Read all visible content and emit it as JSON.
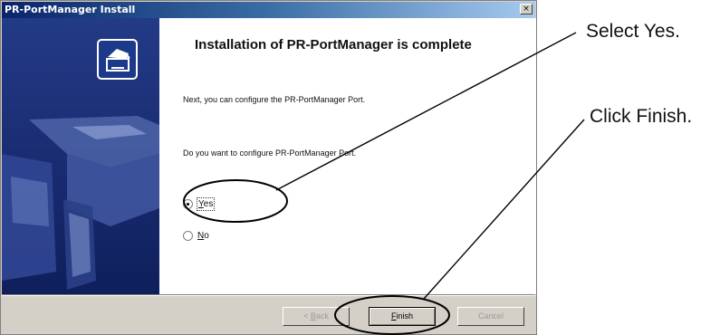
{
  "window": {
    "title": "PR-PortManager Install",
    "close_glyph": "×"
  },
  "content": {
    "heading": "Installation of PR-PortManager is complete",
    "message1": "Next, you can configure the PR-PortManager Port.",
    "message2": "Do you want to configure PR-PortManager Port.",
    "options": [
      {
        "accesskey": "Y",
        "rest": "es",
        "selected": true
      },
      {
        "accesskey": "N",
        "rest": "o",
        "selected": false
      }
    ]
  },
  "buttons": {
    "back_prefix": "< ",
    "back_key": "B",
    "back_rest": "ack",
    "finish_key": "F",
    "finish_rest": "inish",
    "cancel": "Cancel"
  },
  "annotations": {
    "select_yes": "Select Yes.",
    "click_finish": "Click Finish."
  },
  "icons": [
    "printer-setup-icon",
    "printer-illustration"
  ]
}
